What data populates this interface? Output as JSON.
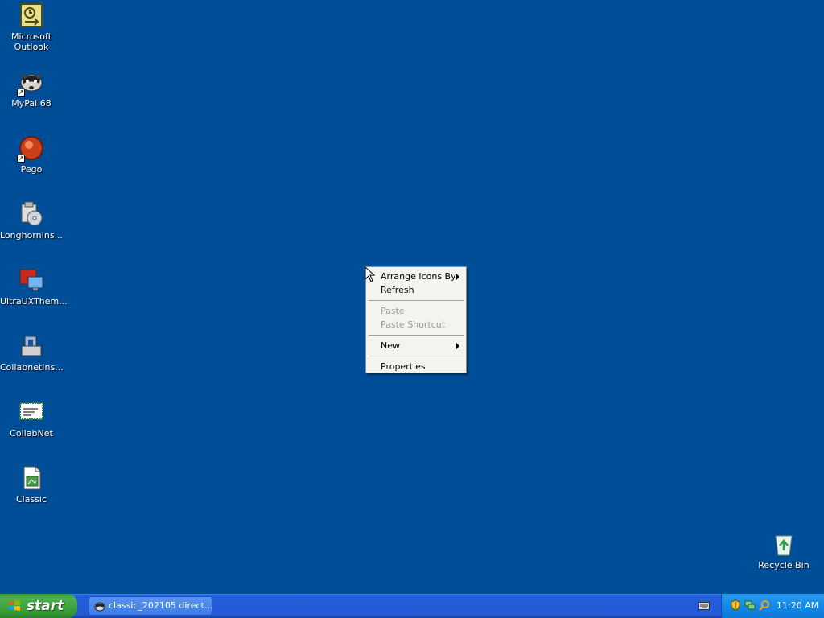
{
  "desktop": {
    "icons": [
      {
        "label": "Microsoft\nOutlook"
      },
      {
        "label": "MyPal 68"
      },
      {
        "label": "Pego"
      },
      {
        "label": "LonghornIns..."
      },
      {
        "label": "UltraUXThem..."
      },
      {
        "label": "CollabnetIns..."
      },
      {
        "label": "CollabNet"
      },
      {
        "label": "Classic"
      },
      {
        "label": "Recycle Bin"
      }
    ]
  },
  "context_menu": {
    "items": [
      {
        "label": "Arrange Icons By",
        "has_submenu": true,
        "enabled": true
      },
      {
        "label": "Refresh",
        "enabled": true
      },
      {
        "label": "Paste",
        "enabled": false
      },
      {
        "label": "Paste Shortcut",
        "enabled": false
      },
      {
        "label": "New",
        "has_submenu": true,
        "enabled": true
      },
      {
        "label": "Properties",
        "enabled": true
      }
    ]
  },
  "taskbar": {
    "start_label": "start",
    "task_button_label": "classic_202105 direct...",
    "clock": "11:20 AM"
  },
  "colors": {
    "desktop_background": "#004e98",
    "taskbar_blue": "#235bd6",
    "start_green": "#3c9b3c"
  }
}
